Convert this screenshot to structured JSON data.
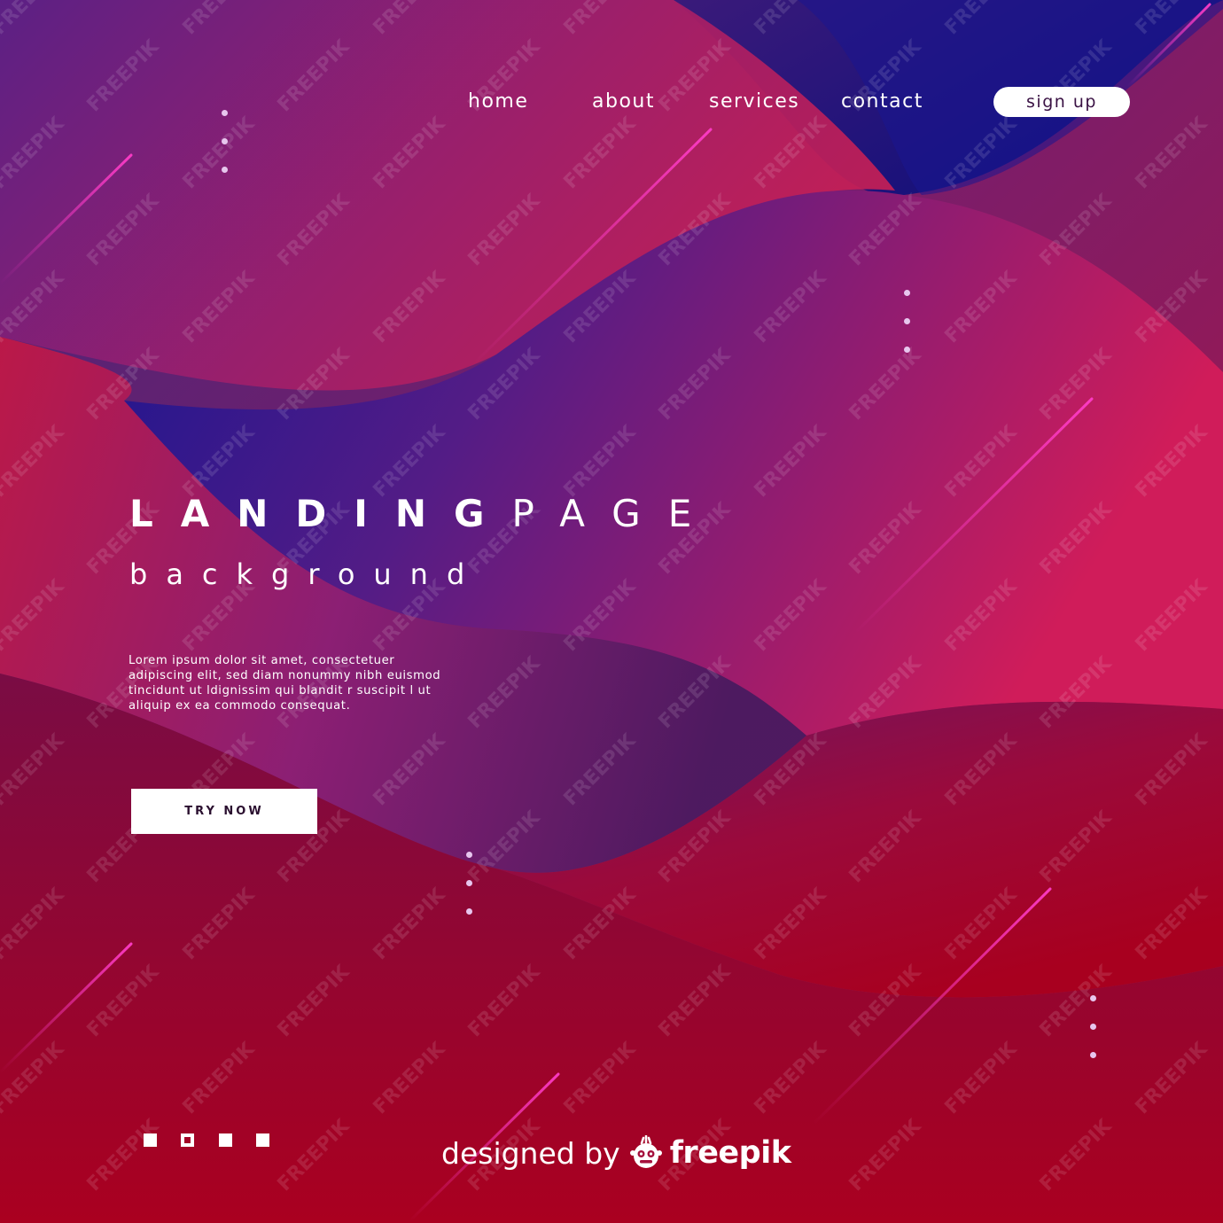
{
  "nav": {
    "items": [
      {
        "label": "home"
      },
      {
        "label": "about"
      },
      {
        "label": "services"
      },
      {
        "label": "contact"
      }
    ],
    "signup_label": "sign up"
  },
  "hero": {
    "title_bold": "LANDING",
    "title_light": "PAGE",
    "subtitle": "background",
    "body": "Lorem ipsum dolor sit amet, consectetuer adipiscing elit, sed diam nonummy nibh euismod tincidunt ut ldignissim qui blandit r suscipit l ut aliquip ex ea commodo consequat.",
    "cta_label": "TRY NOW"
  },
  "pagination": {
    "count": 4,
    "active_index": 1
  },
  "credit": {
    "prefix": "designed by",
    "brand": "freepik",
    "logo_icon": "freepik-logo-icon"
  },
  "watermark": "FREEPIK",
  "colors": {
    "deep_blue": "#1a1585",
    "purple": "#5a1a7c",
    "magenta": "#c01a5a",
    "crimson": "#a3002c",
    "accent_line": "#ff3cc8",
    "white": "#ffffff"
  }
}
